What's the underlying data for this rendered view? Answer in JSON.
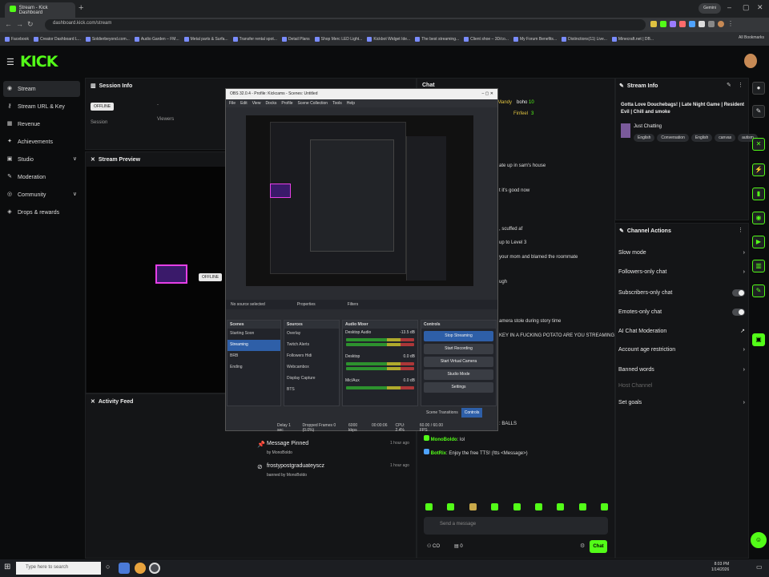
{
  "browser": {
    "tab_title": "Stream - Kick Dashboard",
    "url": "dashboard.kick.com/stream",
    "profile_button": "Gemini",
    "bookmarks": [
      "Facebook",
      "Creator Dashboard L...",
      "Soldierbeyond.com...",
      "Audio Garden – FM...",
      "Metal parts & Surfa...",
      "Transfer rental spot...",
      "Detail Plans",
      "Shop Merc LED Light...",
      "Kickbot Widget Ide...",
      "The best streaming...",
      "Client shoe – 3D/co...",
      "My Forum Benefits...",
      "Distinctions(11) Live...",
      "Minecraft.net | DB..."
    ],
    "all_bookmarks": "All Bookmarks"
  },
  "kick": {
    "logo": "KICK"
  },
  "sidebar": {
    "items": [
      {
        "label": "Stream"
      },
      {
        "label": "Stream URL & Key"
      },
      {
        "label": "Revenue"
      },
      {
        "label": "Achievements"
      },
      {
        "label": "Studio"
      },
      {
        "label": "Moderation"
      },
      {
        "label": "Community"
      },
      {
        "label": "Drops & rewards"
      }
    ]
  },
  "session": {
    "title": "Session Info",
    "status": "OFFLINE",
    "session_label": "Session",
    "viewers_label": "Viewers",
    "viewers_value": "-"
  },
  "preview": {
    "title": "Stream Preview",
    "status": "OFFLINE"
  },
  "activity": {
    "title": "Activity Feed",
    "items": [
      {
        "title": "Message Pinned",
        "sub": "by MonoBoldo",
        "time": "1 hour ago"
      },
      {
        "title": "frostypostgraduateyscz",
        "sub": "banned by MonoBoldo",
        "time": "1 hour ago"
      }
    ]
  },
  "obs": {
    "title": "OBS 32.0.4 - Profile: Kickcams - Scenes: Untitled",
    "menu": [
      "File",
      "Edit",
      "View",
      "Docks",
      "Profile",
      "Scene Collection",
      "Tools",
      "Help"
    ],
    "no_source": "No source selected",
    "properties": "Properties",
    "filters": "Filters",
    "scenes_title": "Scenes",
    "scenes": [
      "Starting Soon",
      "Streaming",
      "BRB",
      "Ending"
    ],
    "sources_title": "Sources",
    "sources": [
      "Overlay",
      "Twitch Alerts",
      "Followers Hidi",
      "Webcambox",
      "Display Capture",
      "BTS"
    ],
    "mixer_title": "Audio Mixer",
    "mixer": [
      {
        "name": "Desktop Audio",
        "db": "-13.5 dB"
      },
      {
        "name": "Desktop",
        "db": "0.0 dB"
      },
      {
        "name": "Mic/Aux",
        "db": "0.0 dB"
      }
    ],
    "controls_title": "Controls",
    "controls": [
      "Stop Streaming",
      "Start Recording",
      "Start Virtual Camera",
      "Studio Mode",
      "Settings"
    ],
    "scene_transitions": "Scene Transitions",
    "controls_tab": "Controls",
    "status": [
      "Delay 1 sec",
      "Dropped Frames 0 (0.0%)",
      "6000 kbps",
      "00:00:06",
      "CPU: 2.4%",
      "60.00 / 60.00 FPS"
    ]
  },
  "chat": {
    "title": "Chat",
    "top_users": [
      {
        "name": "Mandy"
      },
      {
        "name": "boho",
        "count": "10"
      },
      {
        "name": "Finfeel",
        "count": "3"
      }
    ],
    "lines": [
      "ate up in sam's house",
      "t it's good now",
      ", scuffed af",
      "up to Level 3",
      "your mom and blamed the roommate",
      "ugh",
      "amera stole during story time",
      "KEY IN A FUCKING POTATO ARE YOU STREAMING",
      ": BALLS"
    ],
    "mono_msg": {
      "user": "MonoBoldo",
      "text": "lol"
    },
    "bot_msg": {
      "user": "BotRix",
      "text": "Enjoy the free TTS! (!tts <Message>)"
    },
    "placeholder": "Send a message",
    "points": "CO",
    "count": "0",
    "send": "Chat"
  },
  "stream_info": {
    "title": "Stream Info",
    "stream_title": "Gotta Love Douchebags! | Late Night Game | Resident Evil | Chill and smoke",
    "category": "Just Chatting",
    "tags": [
      "English",
      "Conversation",
      "English",
      "canvas",
      "autism"
    ]
  },
  "channel_actions": {
    "title": "Channel Actions",
    "items": [
      {
        "label": "Slow mode",
        "kind": "chevron"
      },
      {
        "label": "Followers-only chat",
        "kind": "chevron"
      },
      {
        "label": "Subscribers-only chat",
        "kind": "toggle"
      },
      {
        "label": "Emotes-only chat",
        "kind": "toggle"
      },
      {
        "label": "AI Chat Moderation",
        "kind": "link"
      },
      {
        "label": "Account age restriction",
        "kind": "chevron"
      },
      {
        "label": "Banned words",
        "kind": "chevron"
      },
      {
        "label": "Host Channel",
        "kind": "disabled"
      },
      {
        "label": "Set goals",
        "kind": "chevron"
      }
    ]
  },
  "taskbar": {
    "search_placeholder": "Type here to search",
    "time": "8:03 PM",
    "date": "1/14/2026"
  },
  "colors": {
    "accent": "#53fc18",
    "panel": "#141517",
    "background": "#0b0c0d"
  }
}
